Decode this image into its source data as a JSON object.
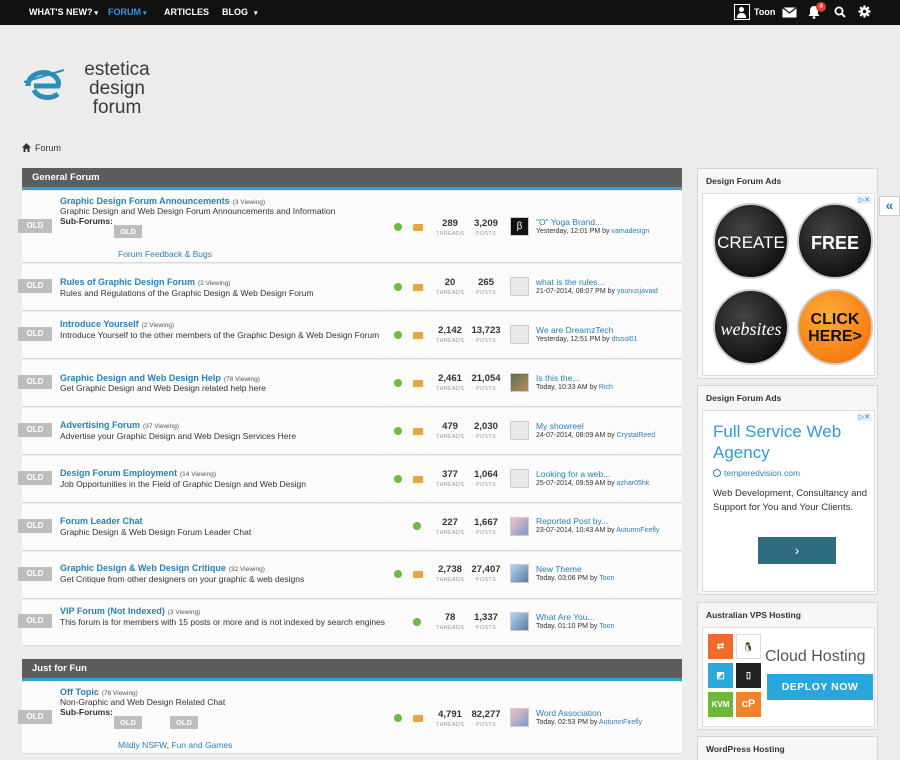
{
  "nav": {
    "items": [
      {
        "label": "WHAT'S NEW?",
        "caret": "▾"
      },
      {
        "label": "FORUM",
        "caret": "▾"
      },
      {
        "label": "ARTICLES",
        "caret": ""
      },
      {
        "label": "BLOG",
        "caret": "▾"
      }
    ],
    "user_name": "Toon",
    "notification_count": "4",
    "icons": [
      "user-icon",
      "mail-icon",
      "bell-icon",
      "search-icon",
      "gear-icon"
    ]
  },
  "logo": {
    "line1": "estetica",
    "line2": "design",
    "line3": "forum"
  },
  "breadcrumb": {
    "label": "Forum"
  },
  "sections": [
    {
      "title": "General Forum",
      "rows": [
        {
          "title": "Graphic Design Forum Announcements",
          "viewing": "(3 Viewing)",
          "desc": "Graphic Design and Web Design Forum Announcements and Information",
          "subforums_label": "Sub-Forums:",
          "subforums": "Forum Feedback & Bugs",
          "threads": "289",
          "posts": "3,209",
          "last_title": "\"O\" Yoga Brand...",
          "last_time": "Yesterday, 12:01 PM by",
          "last_by": "vamadesign",
          "avatar_char": "β"
        },
        {
          "title": "Rules of Graphic Design Forum",
          "viewing": "(2 Viewing)",
          "desc": "Rules and Regulations of the Graphic Design & Web Design Forum",
          "threads": "20",
          "posts": "265",
          "last_title": "what is the rules...",
          "last_time": "21-07-2014, 08:07 PM by",
          "last_by": "younusjavaid"
        },
        {
          "title": "Introduce Yourself",
          "viewing": "(2 Viewing)",
          "desc": "Introduce Yourself to the other members of the Graphic Design & Web Design Forum",
          "threads": "2,142",
          "posts": "13,723",
          "last_title": "We are DreamzTech",
          "last_time": "Yesterday, 12:51 PM by",
          "last_by": "dtssol01"
        },
        {
          "title": "Graphic Design and Web Design Help",
          "viewing": "(78 Viewing)",
          "desc": "Get Graphic Design and Web Design related help here",
          "threads": "2,461",
          "posts": "21,054",
          "last_title": "Is this the...",
          "last_time": "Today, 10:33 AM by",
          "last_by": "Rich"
        },
        {
          "title": "Advertising Forum",
          "viewing": "(37 Viewing)",
          "desc": "Advertise your Graphic Design and Web Design Services Here",
          "threads": "479",
          "posts": "2,030",
          "last_title": "My showreel",
          "last_time": "24-07-2014, 08:09 AM by",
          "last_by": "CrystalReed"
        },
        {
          "title": "Design Forum Employment",
          "viewing": "(14 Viewing)",
          "desc": "Job Opportunities in the Field of Graphic Design and Web Design",
          "threads": "377",
          "posts": "1,064",
          "last_title": "Looking for a web...",
          "last_time": "25-07-2014, 09:59 AM by",
          "last_by": "azhar05hk"
        },
        {
          "title": "Forum Leader Chat",
          "viewing": "",
          "desc": "Graphic Design & Web Design Forum Leader Chat",
          "threads": "227",
          "posts": "1,667",
          "last_title": "Reported Post by...",
          "last_time": "23-07-2014, 10:43 AM by",
          "last_by": "AutumnFirefly"
        },
        {
          "title": "Graphic Design & Web Design Critique",
          "viewing": "(32 Viewing)",
          "desc": "Get Critique from other designers on your graphic & web designs",
          "threads": "2,738",
          "posts": "27,407",
          "last_title": "New Theme",
          "last_time": "Today, 03:06 PM by",
          "last_by": "Toon"
        },
        {
          "title": "VIP Forum (Not Indexed)",
          "viewing": "(3 Viewing)",
          "desc": "This forum is for members with 15 posts or more and is not indexed by search engines",
          "threads": "78",
          "posts": "1,337",
          "last_title": "What Are You...",
          "last_time": "Today, 01:10 PM by",
          "last_by": "Toon"
        }
      ]
    },
    {
      "title": "Just for Fun",
      "rows": [
        {
          "title": "Off Topic",
          "viewing": "(78 Viewing)",
          "desc": "Non-Graphic and Web Design Related Chat",
          "subforums_label": "Sub-Forums:",
          "subforum1": "Mildly NSFW",
          "subforum_sep": ",",
          "subforum2": "Fun and Games",
          "threads": "4,791",
          "posts": "82,277",
          "last_title": "Word Association",
          "last_time": "Today, 02:53 PM by",
          "last_by": "AutumnFirefly"
        }
      ]
    }
  ],
  "labels": {
    "old": "OLD",
    "threads": "THREADS",
    "posts": "POSTS"
  },
  "sidebar": {
    "toggle": "«",
    "ad1": {
      "title": "Design Forum Ads",
      "circles": [
        "CREATE",
        "FREE",
        "websites",
        "CLICK HERE>"
      ]
    },
    "ad2": {
      "title": "Design Forum Ads",
      "headline": "Full Service Web Agency",
      "url": "temperedvision.com",
      "body": "Web Development, Consultancy and Support for You and Your Clients.",
      "button": "›"
    },
    "ad3": {
      "title": "Australian VPS Hosting",
      "tiles": [
        "KVM",
        "cP"
      ],
      "cloud": "Cloud Hosting",
      "deploy": "DEPLOY NOW"
    },
    "ad4": {
      "title": "WordPress Hosting"
    }
  }
}
